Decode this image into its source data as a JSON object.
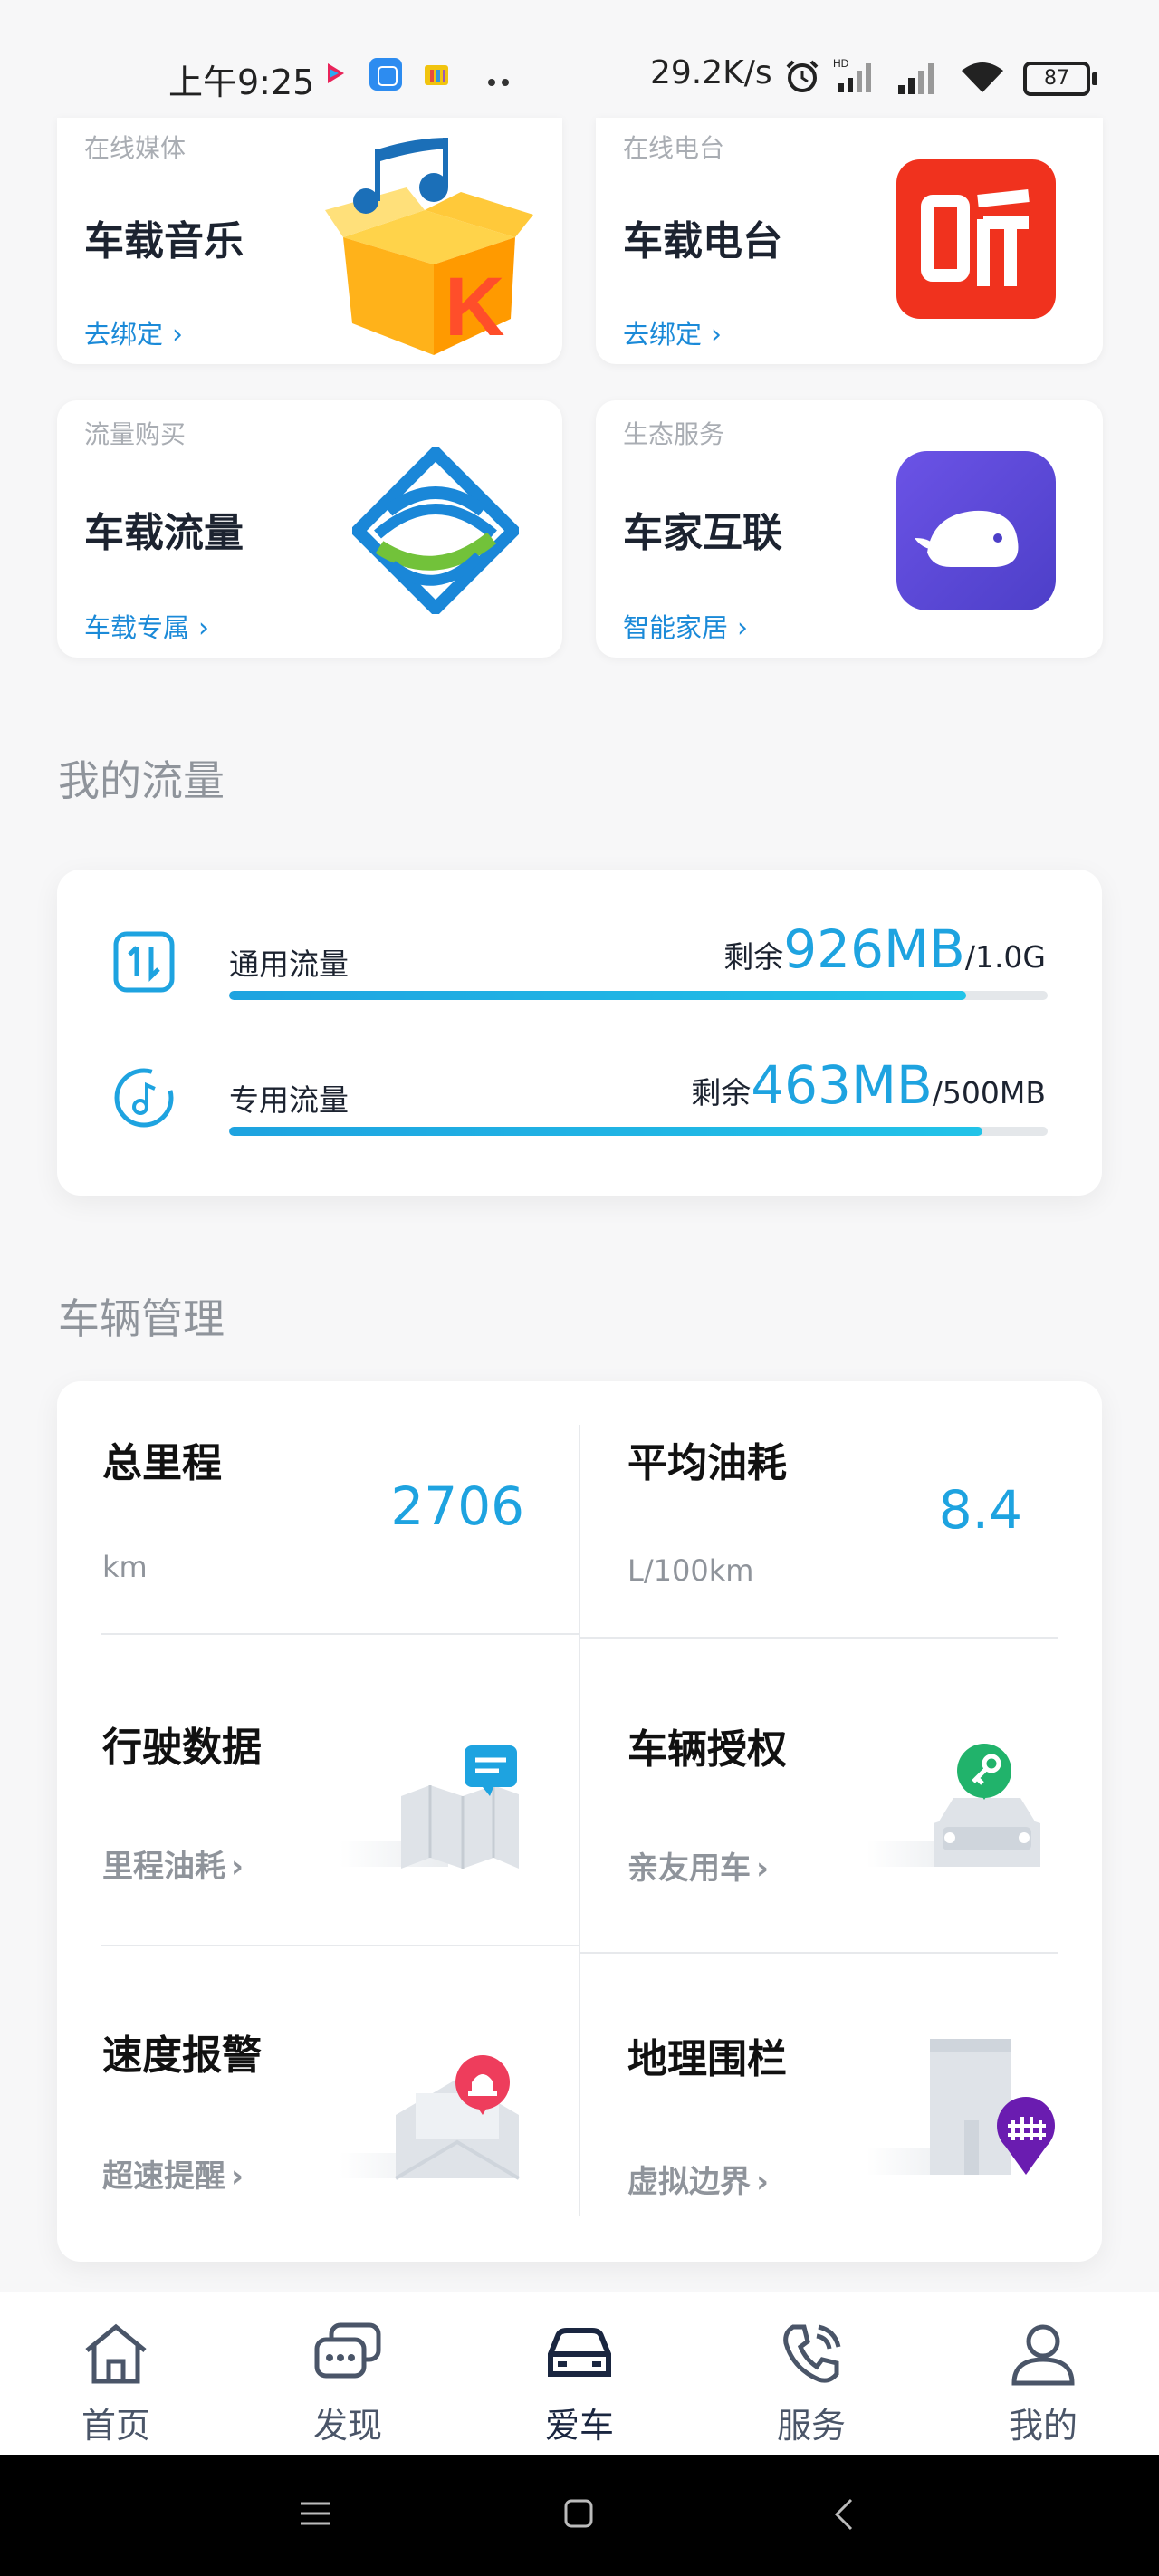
{
  "status_bar": {
    "time": "上午9:25",
    "network_speed": "29.2K/s",
    "battery": "87"
  },
  "services": [
    {
      "category": "在线媒体",
      "title": "车载音乐",
      "link": "去绑定",
      "icon": "kuwo-music-box-icon"
    },
    {
      "category": "在线电台",
      "title": "车载电台",
      "link": "去绑定",
      "icon": "ting-radio-icon"
    },
    {
      "category": "流量购买",
      "title": "车载流量",
      "link": "车载专属",
      "icon": "china-mobile-logo-icon"
    },
    {
      "category": "生态服务",
      "title": "车家互联",
      "link": "智能家居",
      "icon": "whale-app-icon"
    }
  ],
  "my_flow": {
    "section_title": "我的流量",
    "items": [
      {
        "label": "通用流量",
        "remain_prefix": "剩余",
        "remain_value": "926MB",
        "total": "/1.0G",
        "fraction": 0.9
      },
      {
        "label": "专用流量",
        "remain_prefix": "剩余",
        "remain_value": "463MB",
        "total": "/500MB",
        "fraction": 0.92
      }
    ]
  },
  "vehicle": {
    "section_title": "车辆管理",
    "mileage": {
      "title": "总里程",
      "value": "2706",
      "unit": "km"
    },
    "fuel": {
      "title": "平均油耗",
      "value": "8.4",
      "unit": "L/100km"
    },
    "tiles": [
      {
        "title": "行驶数据",
        "link": "里程油耗",
        "icon": "map-chat-icon"
      },
      {
        "title": "车辆授权",
        "link": "亲友用车",
        "icon": "car-key-icon"
      },
      {
        "title": "速度报警",
        "link": "超速提醒",
        "icon": "alarm-envelope-icon"
      },
      {
        "title": "地理围栏",
        "link": "虚拟边界",
        "icon": "fence-pin-icon"
      }
    ]
  },
  "bottom_nav": [
    {
      "label": "首页",
      "icon": "home-icon"
    },
    {
      "label": "发现",
      "icon": "chat-bubbles-icon"
    },
    {
      "label": "爱车",
      "icon": "car-icon",
      "active": true
    },
    {
      "label": "服务",
      "icon": "phone-icon"
    },
    {
      "label": "我的",
      "icon": "user-icon"
    }
  ],
  "colors": {
    "accent": "#1ea3e0",
    "link": "#1b8ad8",
    "title": "#1c2330",
    "muted": "#8f949b",
    "background": "#f7f7f8"
  }
}
